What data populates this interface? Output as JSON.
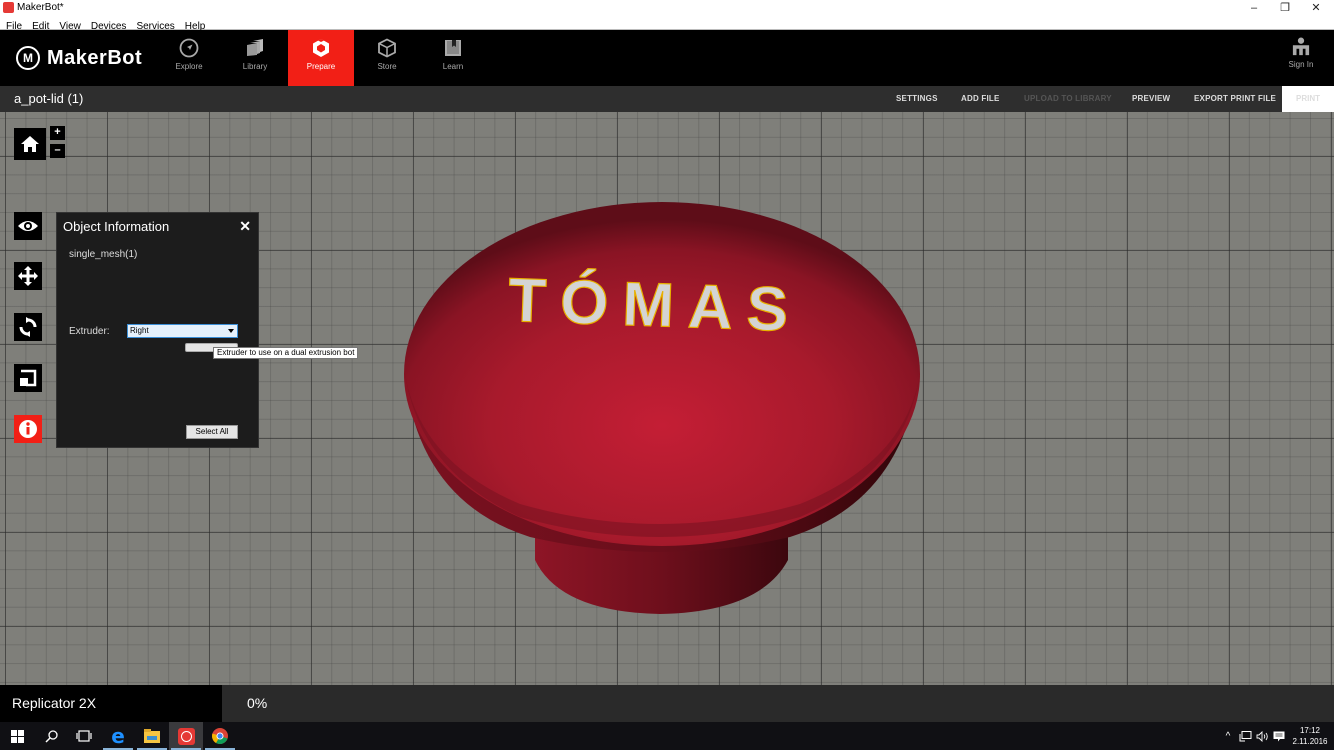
{
  "window": {
    "title": "MakerBot*",
    "controls": {
      "minimize": "–",
      "restore": "❐",
      "close": "✕"
    }
  },
  "menu": [
    "File",
    "Edit",
    "View",
    "Devices",
    "Services",
    "Help"
  ],
  "nav": {
    "logo_text": "MakerBot",
    "tabs": [
      {
        "label": "Explore",
        "icon": "compass-icon",
        "active": false
      },
      {
        "label": "Library",
        "icon": "library-icon",
        "active": false
      },
      {
        "label": "Prepare",
        "icon": "prepare-icon",
        "active": true
      },
      {
        "label": "Store",
        "icon": "store-box-icon",
        "active": false
      },
      {
        "label": "Learn",
        "icon": "learn-book-icon",
        "active": false
      }
    ],
    "sign_in": "Sign In",
    "accent": "#f21f16"
  },
  "toolbar": {
    "file_name": "a_pot-lid (1)",
    "settings": "SETTINGS",
    "add_file": "ADD FILE",
    "upload_to_library": "UPLOAD TO LIBRARY",
    "preview": "PREVIEW",
    "export_print_file": "EXPORT PRINT FILE",
    "print": "PRINT"
  },
  "view_controls": {
    "zoom_in": "+",
    "zoom_out": "–"
  },
  "object_panel": {
    "title": "Object Information",
    "close": "✕",
    "mesh_name": "single_mesh(1)",
    "extruder_label": "Extruder:",
    "extruder_value": "Right",
    "tooltip": "Extruder to use on a dual extrusion bot",
    "select_all": "Select All"
  },
  "model": {
    "text": "TÓMAS",
    "color": "#b81c2e",
    "text_color": "#d4d4d4"
  },
  "status": {
    "printer": "Replicator 2X",
    "progress": "0%"
  },
  "taskbar": {
    "time": "17:12",
    "date": "2.11.2016"
  }
}
